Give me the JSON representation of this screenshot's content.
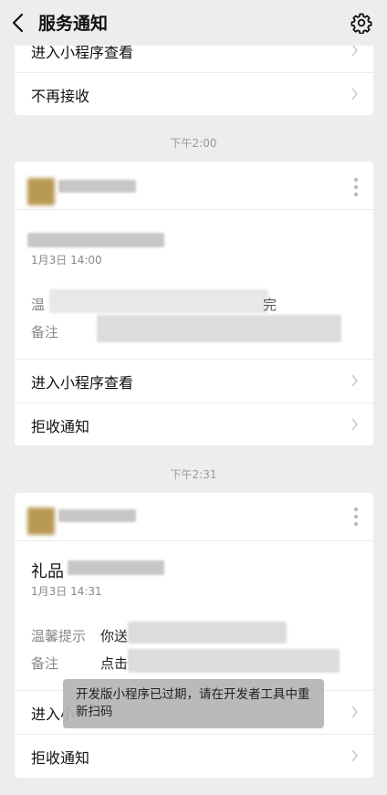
{
  "nav": {
    "title": "服务通知"
  },
  "card0": {
    "enter_label": "进入小程序查看",
    "reject_label": "不再接收"
  },
  "card1": {
    "time": "下午2:00",
    "date": "1月3日  14:00",
    "field1_label": "温",
    "field1_tail": "完",
    "field2_label": "备注",
    "enter_label": "进入小程序查看",
    "reject_label": "拒收通知"
  },
  "card2": {
    "time": "下午2:31",
    "title_prefix": "礼品",
    "date": "1月3日  14:31",
    "field1_label": "温馨提示",
    "field1_value": "你送",
    "field2_label": "备注",
    "field2_value": "点击查",
    "enter_label": "进入小",
    "reject_label": "拒收通知"
  },
  "toast": {
    "text": "开发版小程序已过期，请在开发者工具中重新扫码"
  }
}
